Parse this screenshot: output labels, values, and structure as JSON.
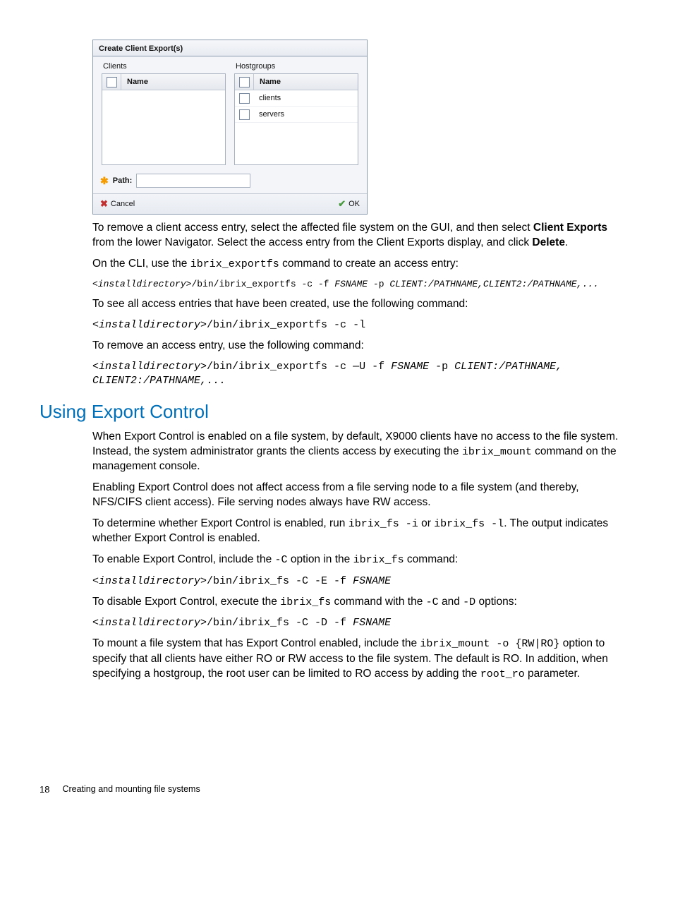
{
  "dialog": {
    "title": "Create Client Export(s)",
    "clients_header": "Clients",
    "hostgroups_header": "Hostgroups",
    "name_col": "Name",
    "hg_rows": [
      "clients",
      "servers"
    ],
    "path_label": "Path:",
    "cancel": "Cancel",
    "ok": "OK"
  },
  "para1_a": "To remove a client access entry, select the affected file system on the GUI, and then select ",
  "para1_b": "Client Exports",
  "para1_c": " from the lower Navigator. Select the access entry from the Client Exports display, and click ",
  "para1_d": "Delete",
  "para1_e": ".",
  "para2_a": "On the CLI, use the ",
  "para2_b": "ibrix_exportfs",
  "para2_c": " command to create an access entry:",
  "code1_a": "<installdirectory>",
  "code1_b": "/bin/ibrix_exportfs -c -f ",
  "code1_c": "FSNAME",
  "code1_d": " -p ",
  "code1_e": "CLIENT:/PATHNAME,CLIENT2:/PATHNAME,...",
  "para3": "To see all access entries that have been created, use the following command:",
  "code2_a": "<installdirectory>",
  "code2_b": "/bin/ibrix_exportfs -c -l",
  "para4": "To remove an access entry, use the following command:",
  "code3_a": "<installdirectory>",
  "code3_b": "/bin/ibrix_exportfs -c —U -f ",
  "code3_c": "FSNAME",
  "code3_d": " -p ",
  "code3_e": "CLIENT:/PATHNAME, CLIENT2:/PATHNAME,...",
  "heading": "Using Export Control",
  "p5_a": "When Export Control is enabled on a file system, by default, X9000 clients have no access to the file system. Instead, the system administrator grants the clients access by executing the ",
  "p5_b": "ibrix_mount",
  "p5_c": " command on the management console.",
  "p6": "Enabling Export Control does not affect access from a file serving node to a file system (and thereby, NFS/CIFS client access). File serving nodes always have RW access.",
  "p7_a": "To determine whether Export Control is enabled, run ",
  "p7_b": "ibrix_fs -i",
  "p7_c": " or ",
  "p7_d": "ibrix_fs -l",
  "p7_e": ". The output indicates whether Export Control is enabled.",
  "p8_a": "To enable Export Control, include the ",
  "p8_b": "-C",
  "p8_c": " option in the ",
  "p8_d": "ibrix_fs",
  "p8_e": " command:",
  "code4_a": "<installdirectory>",
  "code4_b": "/bin/ibrix_fs -C -E -f ",
  "code4_c": "FSNAME",
  "p9_a": "To disable Export Control, execute the ",
  "p9_b": "ibrix_fs",
  "p9_c": " command with the ",
  "p9_d": "-C",
  "p9_e": " and ",
  "p9_f": "-D",
  "p9_g": " options:",
  "code5_a": "<installdirectory>",
  "code5_b": "/bin/ibrix_fs -C -D -f ",
  "code5_c": "FSNAME",
  "p10_a": "To mount a file system that has Export Control enabled, include the ",
  "p10_b": "ibrix_mount -o {RW|RO}",
  "p10_c": " option to specify that all clients have either RO or RW access to the file system. The default is RO. In addition, when specifying a hostgroup, the root user can be limited to RO access by adding the ",
  "p10_d": "root_ro",
  "p10_e": " parameter.",
  "footer_page": "18",
  "footer_title": "Creating and mounting file systems"
}
